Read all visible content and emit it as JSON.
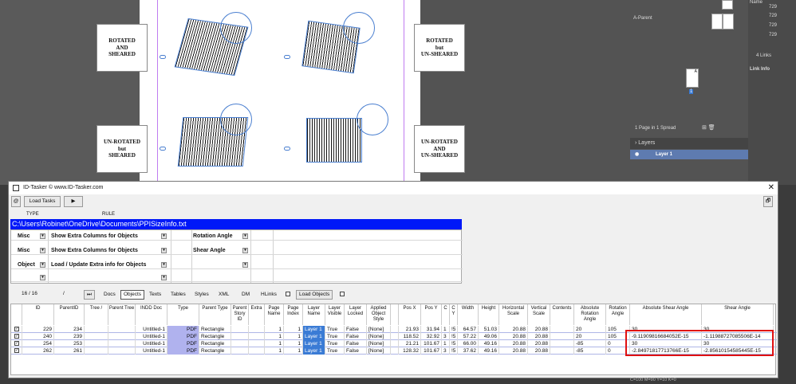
{
  "indesign": {
    "labels": {
      "top_left": "ROTATED\nAND\nSHEARED",
      "top_right": "ROTATED\nbut\nUN-SHEARED",
      "bottom_left": "UN-ROTATED\nbut\nSHEARED",
      "bottom_right": "UN-ROTATED\nAND\nUN-SHEARED"
    },
    "pages_panel": {
      "master_name": "A-Parent",
      "status": "1 Page in 1 Spread",
      "page_marker": "A",
      "page_number": "1"
    },
    "layers_panel": {
      "title": "Layers",
      "layer_name": "Layer 1"
    },
    "links_panel": {
      "title": "Name",
      "count": "4 Links",
      "info": "Link Info",
      "items": [
        "729",
        "729",
        "729",
        "729"
      ]
    },
    "status_line": "C=100 M=90 Y=10 K=0"
  },
  "window": {
    "title": "ID-Tasker © www.ID-Tasker.com",
    "close": "✕"
  },
  "toolbar": {
    "at": "@",
    "load_tasks": "Load Tasks",
    "play": "▶",
    "restore": "🗗"
  },
  "task_header": {
    "type": "TYPE",
    "rule": "RULE"
  },
  "path": "C:\\Users\\Robinet\\OneDrive\\Documents\\PPISizeInfo.txt",
  "tasks": [
    {
      "type": "Misc",
      "rule": "Show Extra Columns for Objects",
      "param": "Rotation Angle"
    },
    {
      "type": "Misc",
      "rule": "Show Extra Columns for Objects",
      "param": "Shear Angle"
    },
    {
      "type": "Object",
      "rule": "Load / Update Extra info for Objects",
      "param": ""
    },
    {
      "type": "",
      "rule": "",
      "param": ""
    }
  ],
  "tabs": {
    "counter": "16 / 16",
    "slash": "/",
    "skip": "⏭",
    "items": [
      "Docs",
      "Objects",
      "Texts",
      "Tables",
      "Styles",
      "XML",
      "DM",
      "HLinks"
    ],
    "active": "Objects",
    "load_objects": "Load Objects"
  },
  "columns": [
    "ID",
    "ParentID",
    "Tree /",
    "Parent Tree",
    "INDD Doc",
    "Type",
    "Parent Type",
    "Parent Story ID",
    "Extra",
    "Page Name",
    "Page Index",
    "Layer Name",
    "Layer Visible",
    "Layer Locked",
    "Applied Object Style",
    "Pos X",
    "Pos Y",
    "C",
    "C Y",
    "Width",
    "Height",
    "Horizontal Scale",
    "Vertical Scale",
    "Contents",
    "Absolute Rotation Angle",
    "Rotation Angle",
    "Absolute Shear Angle",
    "Shear Angle"
  ],
  "rows": [
    {
      "check": "✓",
      "id": "229",
      "parent": "234",
      "doc": "Untitled-1",
      "type": "PDF",
      "ptype": "Rectangle",
      "page": "1",
      "index": "1",
      "layer": "Layer 1",
      "visible": "True",
      "locked": "False",
      "style": "[None]",
      "posx": "21.93",
      "posy": "31.94",
      "c": "1",
      "cy": "!5",
      "width": "64.57",
      "height": "51.03",
      "hscale": "20.88",
      "vscale": "20.88",
      "absrot": "20",
      "rot": "105",
      "absshear": "30",
      "shear": "30"
    },
    {
      "check": "✓",
      "id": "240",
      "parent": "239",
      "doc": "Untitled-1",
      "type": "PDF",
      "ptype": "Rectangle",
      "page": "1",
      "index": "1",
      "layer": "Layer 1",
      "visible": "True",
      "locked": "False",
      "style": "[None]",
      "posx": "118.52",
      "posy": "32.92",
      "c": "3",
      "cy": "!5",
      "width": "57.22",
      "height": "49.06",
      "hscale": "20.88",
      "vscale": "20.88",
      "absrot": "20",
      "rot": "105",
      "absshear": "-9.11909816684052E-15",
      "shear": "-1.11988727085506E-14"
    },
    {
      "check": "✓",
      "id": "254",
      "parent": "253",
      "doc": "Untitled-1",
      "type": "PDF",
      "ptype": "Rectangle",
      "page": "1",
      "index": "1",
      "layer": "Layer 1",
      "visible": "True",
      "locked": "False",
      "style": "[None]",
      "posx": "21.21",
      "posy": "101.67",
      "c": "1",
      "cy": "!5",
      "width": "66.00",
      "height": "49.16",
      "hscale": "20.88",
      "vscale": "20.88",
      "absrot": "-85",
      "rot": "0",
      "absshear": "30",
      "shear": "30"
    },
    {
      "check": "✓",
      "id": "262",
      "parent": "261",
      "doc": "Untitled-1",
      "type": "PDF",
      "ptype": "Rectangle",
      "page": "1",
      "index": "1",
      "layer": "Layer 1",
      "visible": "True",
      "locked": "False",
      "style": "[None]",
      "posx": "128.32",
      "posy": "101.67",
      "c": "3",
      "cy": "!5",
      "width": "37.62",
      "height": "49.16",
      "hscale": "20.88",
      "vscale": "20.88",
      "absrot": "-85",
      "rot": "0",
      "absshear": "-2.84971817713766E-15",
      "shear": "-2.85610154585445E-15"
    }
  ],
  "colors": {
    "path_bar": "#0018f8",
    "highlight_box": "#e01010",
    "layer_highlight": "#3a7bd5"
  }
}
